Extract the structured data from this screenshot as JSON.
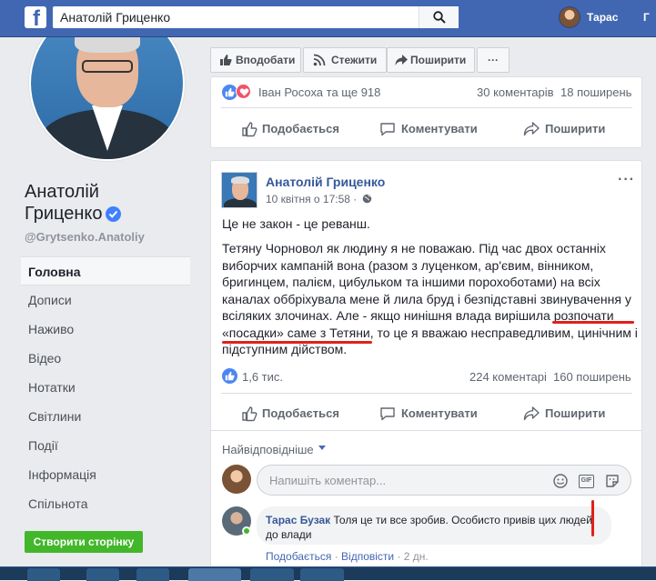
{
  "topbar": {
    "logo": "f",
    "search_value": "Анатолій Гриценко",
    "user_name": "Тарас",
    "user_extra": "Г"
  },
  "profile": {
    "name": "Анатолій Гриценко",
    "handle": "@Grytsenko.Anatoliy",
    "nav": [
      "Головна",
      "Дописи",
      "Наживо",
      "Відео",
      "Нотатки",
      "Світлини",
      "Події",
      "Інформація",
      "Спільнота"
    ],
    "create_page": "Створити сторінку"
  },
  "page_actions": {
    "like": "Вподобати",
    "follow": "Стежити",
    "share": "Поширити",
    "more": "···"
  },
  "prev_post": {
    "reactors": "Іван Росоха та ще 918",
    "comments": "30 коментарів",
    "shares": "18 поширень",
    "like": "Подобається",
    "comment": "Коментувати",
    "share": "Поширити"
  },
  "post": {
    "author": "Анатолій Гриценко",
    "date": "10 квітня о 17:58 ·",
    "menu": "···",
    "title": "Це не закон - це реванш.",
    "body": "Тетяну Чорновол як людину я не поважаю. Під час двох останніх виборчих кампаній вона (разом з луценком, ар'євим, вінником, бригинцем, палієм, цибульком та іншими порохоботами) на всіх каналах оббріхувала мене й лила бруд і безпідставні звинувачення у всіляких злочинах. Але - якщо нинішня влада вирішила розпочати «посадки» саме з Тетяни, то це я вважаю несправедливим, цинічним і підступним дійством.",
    "reactions": "1,6 тис.",
    "comments": "224 коментарі",
    "shares": "160 поширень",
    "like": "Подобається",
    "comment": "Коментувати",
    "share": "Поширити"
  },
  "comments": {
    "sort": "Найвідповідніше",
    "placeholder": "Напишіть коментар...",
    "gif": "GIF",
    "reply": {
      "author": "Тарас Бузак",
      "text": "Толя це ти все зробив. Особисто привів цих людей до влади",
      "like": "Подобається",
      "sep1": " · ",
      "respond": "Відповісти",
      "sep2": " · ",
      "time": "2 дн."
    }
  },
  "colors": {
    "brand": "#4267b2",
    "link": "#365899",
    "annotation": "#e0201a",
    "create_button": "#42b72a"
  }
}
